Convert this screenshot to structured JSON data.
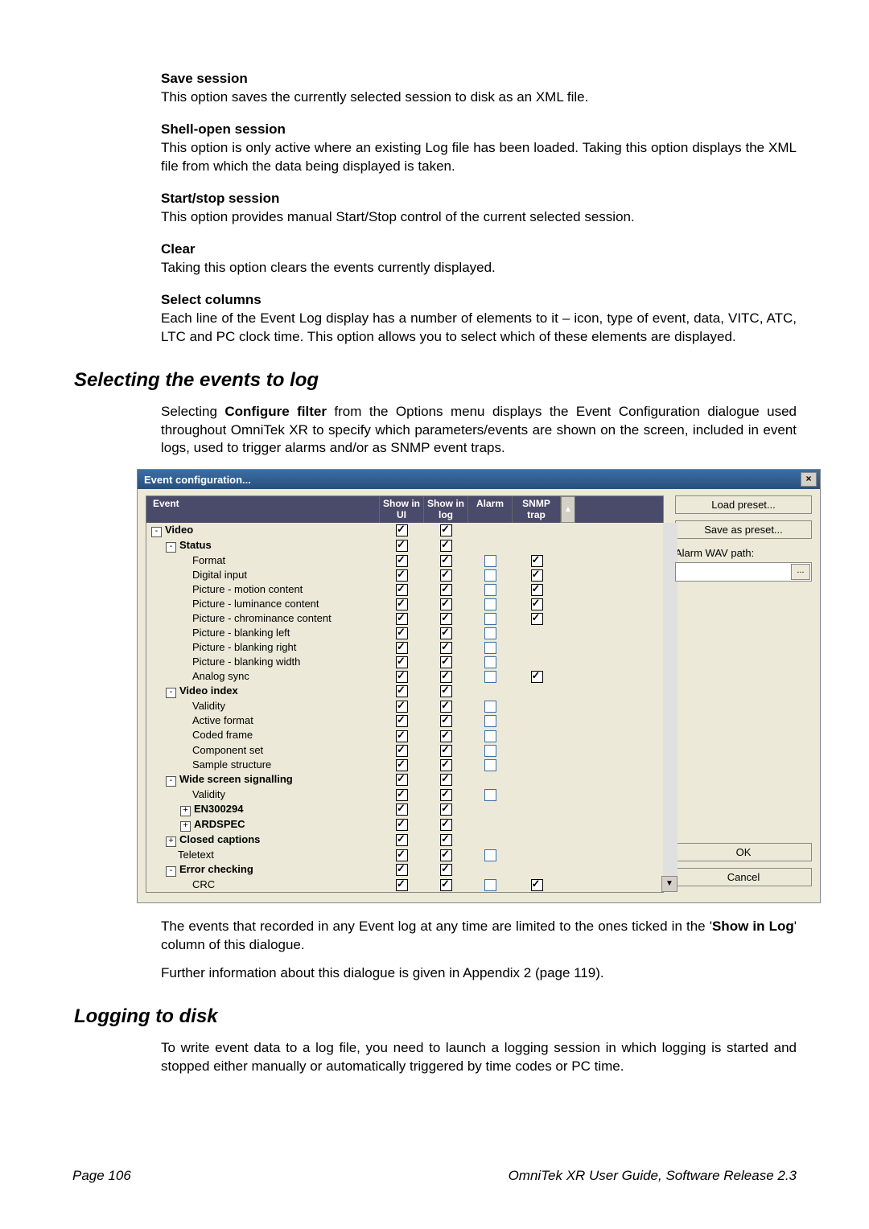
{
  "options": [
    {
      "title": "Save session",
      "text": "This option saves the currently selected session to disk as an XML file.",
      "justify": false
    },
    {
      "title": "Shell-open session",
      "text": "This option is only active where an existing Log file has been loaded. Taking this option displays the XML file from which the data being displayed is taken.",
      "justify": true
    },
    {
      "title": "Start/stop session",
      "text": "This option provides manual Start/Stop control of the current selected session.",
      "justify": false
    },
    {
      "title": "Clear",
      "text": "Taking this option clears the events currently displayed.",
      "justify": false
    },
    {
      "title": "Select columns",
      "text": "Each line of the Event Log display has a number of elements to it – icon, type of event, data, VITC, ATC, LTC and PC clock time. This option allows you to select which of these elements are displayed.",
      "justify": true
    }
  ],
  "section1": {
    "heading": "Selecting the events to log",
    "intro_parts": [
      "Selecting ",
      "Configure filter",
      " from the Options menu displays the Event Configuration dialogue used throughout OmniTek XR to specify which parameters/events are shown on the screen, included in event logs, used to trigger alarms and/or as SNMP event traps."
    ],
    "outro_parts": [
      "The events that recorded in any Event log at any time are limited to the ones ticked in the '",
      "Show in Log",
      "' column of this dialogue."
    ],
    "further": "Further information about this dialogue is given in Appendix 2 (page 119)."
  },
  "dialog": {
    "title": "Event configuration...",
    "headers": {
      "event": "Event",
      "ui": "Show in UI",
      "log": "Show in log",
      "alarm": "Alarm",
      "snmp": "SNMP trap"
    },
    "side": {
      "load": "Load preset...",
      "save": "Save as preset...",
      "wav_label": "Alarm WAV path:",
      "browse": "...",
      "ok": "OK",
      "cancel": "Cancel"
    },
    "rows": [
      {
        "indent": 0,
        "exp": "-",
        "bold": true,
        "label": "Video",
        "ui": 1,
        "log": 1,
        "alarm": null,
        "snmp": null
      },
      {
        "indent": 1,
        "exp": "-",
        "bold": true,
        "label": "Status",
        "ui": 1,
        "log": 1,
        "alarm": null,
        "snmp": null
      },
      {
        "indent": 2,
        "exp": "",
        "bold": false,
        "label": "Format",
        "ui": 1,
        "log": 1,
        "alarm": 0,
        "snmp": 1
      },
      {
        "indent": 2,
        "exp": "",
        "bold": false,
        "label": "Digital input",
        "ui": 1,
        "log": 1,
        "alarm": 0,
        "snmp": 1
      },
      {
        "indent": 2,
        "exp": "",
        "bold": false,
        "label": "Picture - motion content",
        "ui": 1,
        "log": 1,
        "alarm": 0,
        "snmp": 1
      },
      {
        "indent": 2,
        "exp": "",
        "bold": false,
        "label": "Picture - luminance content",
        "ui": 1,
        "log": 1,
        "alarm": 0,
        "snmp": 1
      },
      {
        "indent": 2,
        "exp": "",
        "bold": false,
        "label": "Picture - chrominance content",
        "ui": 1,
        "log": 1,
        "alarm": 0,
        "snmp": 1
      },
      {
        "indent": 2,
        "exp": "",
        "bold": false,
        "label": "Picture - blanking left",
        "ui": 1,
        "log": 1,
        "alarm": 0,
        "snmp": null
      },
      {
        "indent": 2,
        "exp": "",
        "bold": false,
        "label": "Picture - blanking right",
        "ui": 1,
        "log": 1,
        "alarm": 0,
        "snmp": null
      },
      {
        "indent": 2,
        "exp": "",
        "bold": false,
        "label": "Picture - blanking width",
        "ui": 1,
        "log": 1,
        "alarm": 0,
        "snmp": null
      },
      {
        "indent": 2,
        "exp": "",
        "bold": false,
        "label": "Analog sync",
        "ui": 1,
        "log": 1,
        "alarm": 0,
        "snmp": 1
      },
      {
        "indent": 1,
        "exp": "-",
        "bold": true,
        "label": "Video index",
        "ui": 1,
        "log": 1,
        "alarm": null,
        "snmp": null
      },
      {
        "indent": 2,
        "exp": "",
        "bold": false,
        "label": "Validity",
        "ui": 1,
        "log": 1,
        "alarm": 0,
        "snmp": null
      },
      {
        "indent": 2,
        "exp": "",
        "bold": false,
        "label": "Active format",
        "ui": 1,
        "log": 1,
        "alarm": 0,
        "snmp": null
      },
      {
        "indent": 2,
        "exp": "",
        "bold": false,
        "label": "Coded frame",
        "ui": 1,
        "log": 1,
        "alarm": 0,
        "snmp": null
      },
      {
        "indent": 2,
        "exp": "",
        "bold": false,
        "label": "Component set",
        "ui": 1,
        "log": 1,
        "alarm": 0,
        "snmp": null
      },
      {
        "indent": 2,
        "exp": "",
        "bold": false,
        "label": "Sample structure",
        "ui": 1,
        "log": 1,
        "alarm": 0,
        "snmp": null
      },
      {
        "indent": 1,
        "exp": "-",
        "bold": true,
        "label": "Wide screen signalling",
        "ui": 1,
        "log": 1,
        "alarm": null,
        "snmp": null
      },
      {
        "indent": 2,
        "exp": "",
        "bold": false,
        "label": "Validity",
        "ui": 1,
        "log": 1,
        "alarm": 0,
        "snmp": null
      },
      {
        "indent": 2,
        "exp": "+",
        "bold": true,
        "label": "EN300294",
        "ui": 1,
        "log": 1,
        "alarm": null,
        "snmp": null
      },
      {
        "indent": 2,
        "exp": "+",
        "bold": true,
        "label": "ARDSPEC",
        "ui": 1,
        "log": 1,
        "alarm": null,
        "snmp": null
      },
      {
        "indent": 1,
        "exp": "+",
        "bold": true,
        "label": "Closed captions",
        "ui": 1,
        "log": 1,
        "alarm": null,
        "snmp": null
      },
      {
        "indent": 1,
        "exp": "",
        "bold": false,
        "label": "Teletext",
        "ui": 1,
        "log": 1,
        "alarm": 0,
        "snmp": null
      },
      {
        "indent": 1,
        "exp": "-",
        "bold": true,
        "label": "Error checking",
        "ui": 1,
        "log": 1,
        "alarm": null,
        "snmp": null
      },
      {
        "indent": 2,
        "exp": "",
        "bold": false,
        "label": "CRC",
        "ui": 1,
        "log": 1,
        "alarm": 0,
        "snmp": 1
      }
    ]
  },
  "section2": {
    "heading": "Logging to disk",
    "text": "To write event data to a log file, you need to launch a logging session in which logging is started and stopped either manually or automatically triggered by time codes or PC time."
  },
  "footer": {
    "left": "Page 106",
    "right": "OmniTek XR User Guide, Software Release 2.3"
  }
}
